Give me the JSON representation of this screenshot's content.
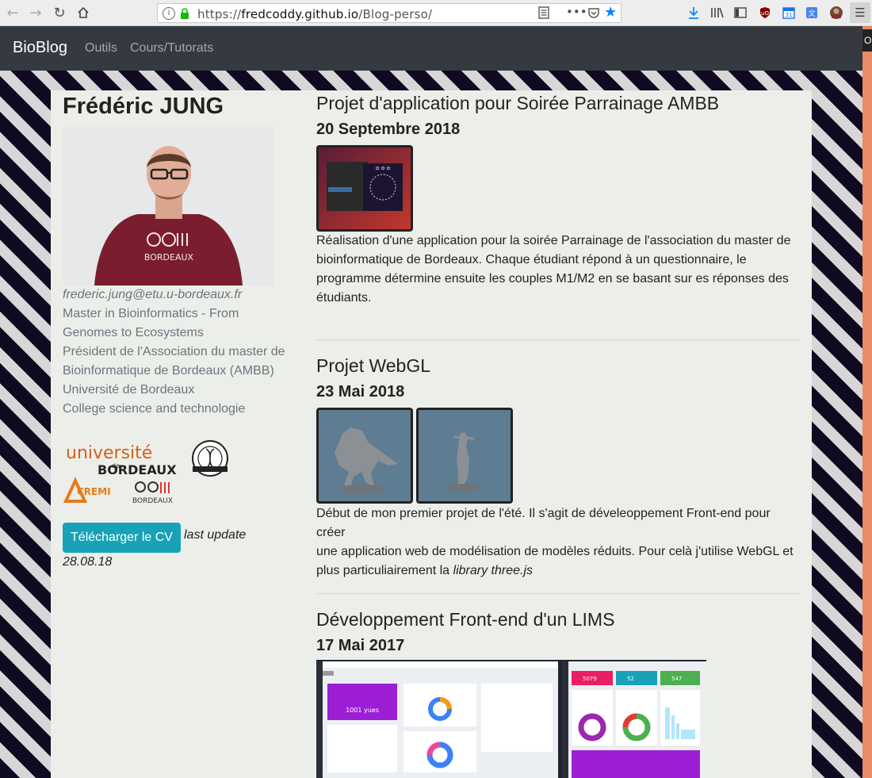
{
  "browser": {
    "url_scheme": "https://",
    "url_host": "fredcoddy.github.io",
    "url_path": "/Blog-perso/",
    "right_panel_tab": "O"
  },
  "navbar": {
    "brand": "BioBlog",
    "links": [
      "Outils",
      "Cours/Tutorats"
    ]
  },
  "profile": {
    "name": "Frédéric JUNG",
    "email": "frederic.jung@etu.u-bordeaux.fr",
    "lines": [
      "Master in Bioinformatics - From",
      "Genomes to Ecosystems",
      "Président de l'Association du master de",
      "Bioinformatique de Bordeaux (AMBB)",
      "Université de Bordeaux",
      "College science and technologie"
    ],
    "logos": {
      "ub_top": "université",
      "ub_de": "de",
      "ub_bottom": "BORDEAUX",
      "cremi": "CREMI",
      "igem_bottom": "BORDEAUX"
    },
    "cv_button": "Télécharger le CV",
    "cv_note": "last update",
    "cv_date": "28.08.18"
  },
  "posts": [
    {
      "title": "Projet d'application pour Soirée Parrainage AMBB",
      "date": "20 Septembre 2018",
      "text_lines": [
        "Réalisation d'une application pour la soirée Parrainage de l'association du master de",
        "bioinformatique de Bordeaux. Chaque étudiant répond à un questionnaire, le",
        "programme détermine ensuite les couples M1/M2 en se basant sur es réponses des",
        "étudiants."
      ]
    },
    {
      "title": "Projet WebGL",
      "date": "23 Mai 2018",
      "text_lines": [
        "Début de mon premier projet de l'été. Il s'agit de déveleoppement Front-end pour créer",
        "une application web de modélisation de modèles réduits. Pour celà j'utilise WebGL et"
      ],
      "text_last_prefix": "plus particuliairement la ",
      "text_last_italic": "library three.js"
    },
    {
      "title": "Développement Front-end d'un LIMS",
      "date": "17 Mai 2017",
      "dashboard_card_value": "1001 yues",
      "stats": [
        "5079",
        "52",
        "547"
      ]
    }
  ]
}
